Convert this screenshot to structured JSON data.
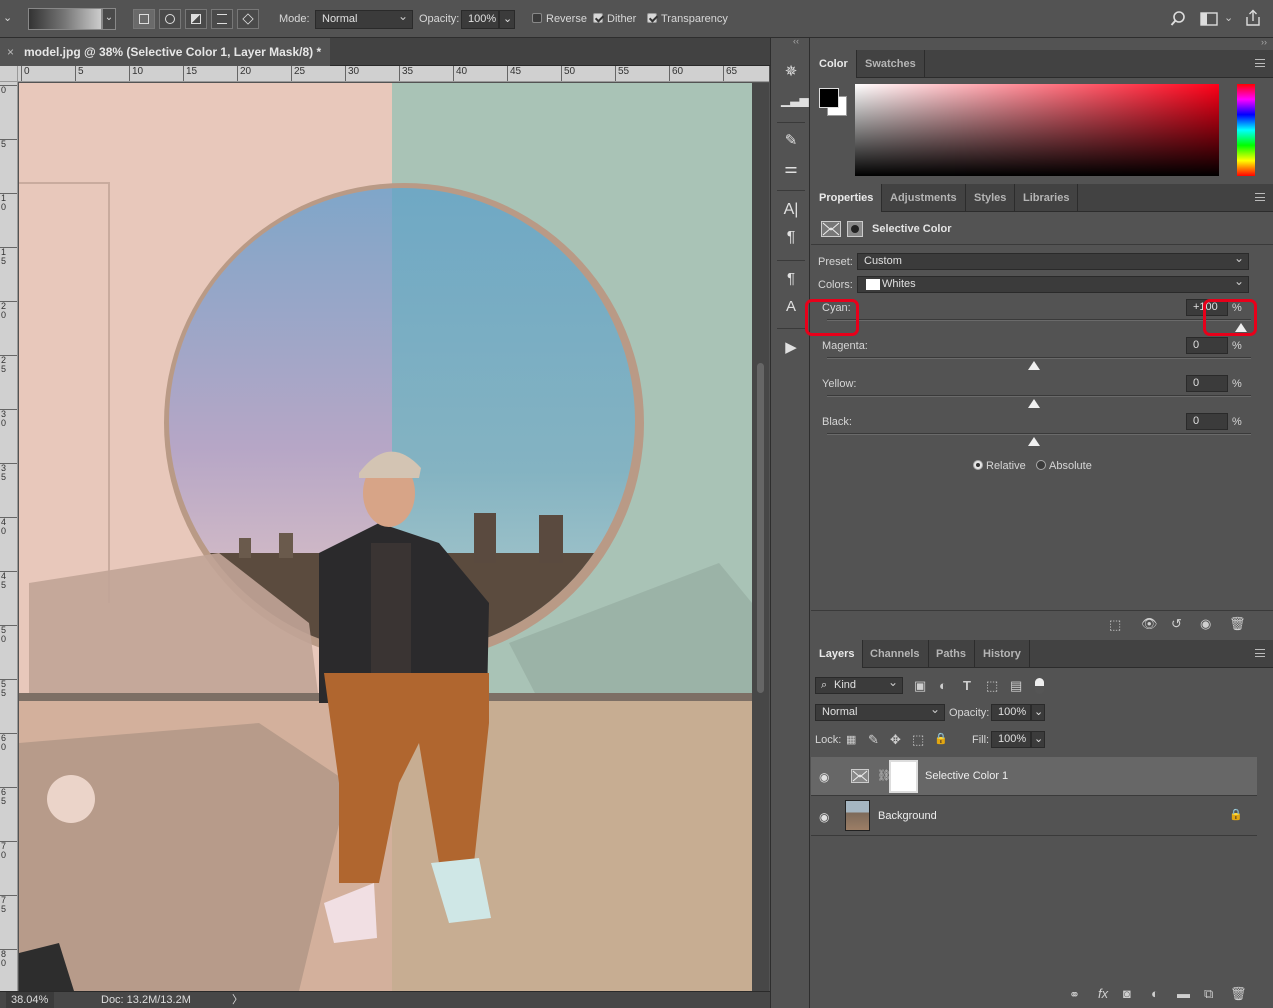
{
  "options_bar": {
    "mode_label": "Mode:",
    "mode_value": "Normal",
    "opacity_label": "Opacity:",
    "opacity_value": "100%",
    "reverse_label": "Reverse",
    "dither_label": "Dither",
    "transparency_label": "Transparency",
    "reverse_checked": false,
    "dither_checked": true,
    "transparency_checked": true
  },
  "document": {
    "tab_title": "model.jpg @ 38% (Selective Color 1, Layer Mask/8) *",
    "close_glyph": "×"
  },
  "rulers": {
    "horizontal": [
      "0",
      "5",
      "10",
      "15",
      "20",
      "25",
      "30",
      "35",
      "40",
      "45",
      "50",
      "55",
      "60",
      "65"
    ],
    "vertical": [
      "0",
      "5",
      "10",
      "15",
      "20",
      "25",
      "30",
      "35",
      "40",
      "45",
      "50",
      "55",
      "60",
      "65",
      "70",
      "75",
      "80"
    ]
  },
  "status_bar": {
    "zoom": "38.04%",
    "doc_info": "Doc: 13.2M/13.2M",
    "arrow": "〉"
  },
  "color_panel": {
    "tabs": [
      "Color",
      "Swatches"
    ],
    "foreground_color": "#000000",
    "background_color": "#ffffff"
  },
  "properties_panel": {
    "tabs": [
      "Properties",
      "Adjustments",
      "Styles",
      "Libraries"
    ],
    "adjustment_title": "Selective Color",
    "preset_label": "Preset:",
    "preset_value": "Custom",
    "colors_label": "Colors:",
    "colors_value": "Whites",
    "sliders": [
      {
        "label": "Cyan:",
        "value": "+100",
        "level": 100
      },
      {
        "label": "Magenta:",
        "value": "0",
        "level": 0
      },
      {
        "label": "Yellow:",
        "value": "0",
        "level": 0
      },
      {
        "label": "Black:",
        "value": "0",
        "level": 0
      }
    ],
    "percent": "%",
    "method_options": [
      "Relative",
      "Absolute"
    ],
    "method_selected": "Relative"
  },
  "layers_panel": {
    "tabs": [
      "Layers",
      "Channels",
      "Paths",
      "History"
    ],
    "filter_value": "Kind",
    "blend_mode": "Normal",
    "opacity_label": "Opacity:",
    "opacity_value": "100%",
    "lock_label": "Lock:",
    "fill_label": "Fill:",
    "fill_value": "100%",
    "layers": [
      {
        "name": "Selective Color 1",
        "selected": true
      },
      {
        "name": "Background",
        "selected": false
      }
    ]
  },
  "icons": {
    "eye": "◉",
    "lock": "🔒",
    "search": "⌕"
  }
}
